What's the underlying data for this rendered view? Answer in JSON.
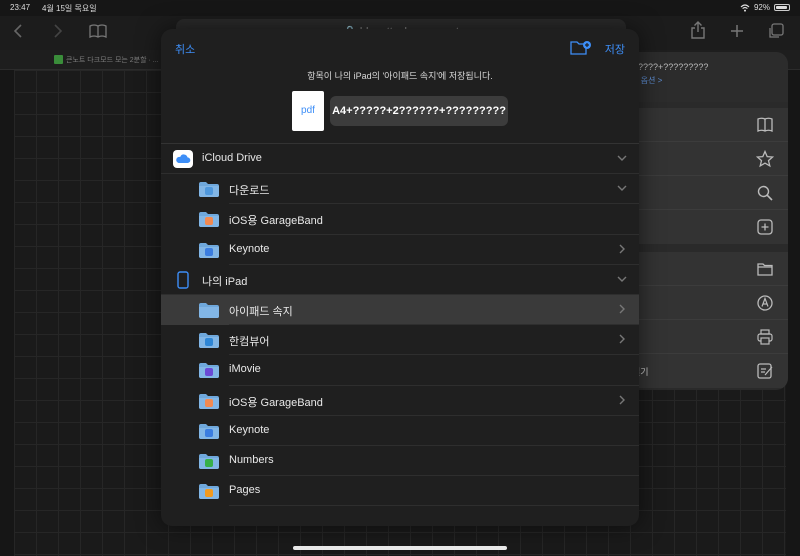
{
  "status_bar": {
    "time": "23:47",
    "date": "4월 15일 목요일",
    "battery": "92%"
  },
  "browser": {
    "url": "🔒 blogattach.naver.net",
    "tab_title": "큰노트 다크모드 모는 2분할 · ..."
  },
  "share_sheet": {
    "title": "????+?????????",
    "options_label": "3 옵션 >",
    "last_label": "결기"
  },
  "dialog": {
    "cancel_label": "취소",
    "save_label": "저장",
    "message": "항목이 나의 iPad의 '아이패드 속지'에 저장됩니다.",
    "file_type_label": "pdf",
    "file_name": "A4+?????+2??????+?????????"
  },
  "locations": [
    {
      "label": "iCloud Drive",
      "level": "root",
      "icon": "icloud-icon",
      "chevron": "down",
      "selected": false
    },
    {
      "label": "다운로드",
      "level": "child",
      "icon": "downloads-folder-icon",
      "chevron": "down",
      "selected": false
    },
    {
      "label": "iOS용 GarageBand",
      "level": "child",
      "icon": "garageband-folder-icon",
      "chevron": "none",
      "selected": false
    },
    {
      "label": "Keynote",
      "level": "child",
      "icon": "keynote-folder-icon",
      "chevron": "right",
      "selected": false
    },
    {
      "label": "나의 iPad",
      "level": "root",
      "icon": "ipad-icon",
      "chevron": "down",
      "selected": false
    },
    {
      "label": "아이패드 속지",
      "level": "child",
      "icon": "folder-icon",
      "chevron": "right",
      "selected": true
    },
    {
      "label": "한컴뷰어",
      "level": "child",
      "icon": "hancom-folder-icon",
      "chevron": "right",
      "selected": false
    },
    {
      "label": "iMovie",
      "level": "child",
      "icon": "imovie-folder-icon",
      "chevron": "none",
      "selected": false
    },
    {
      "label": "iOS용 GarageBand",
      "level": "child",
      "icon": "garageband-folder-icon",
      "chevron": "right",
      "selected": false
    },
    {
      "label": "Keynote",
      "level": "child",
      "icon": "keynote-folder-icon",
      "chevron": "none",
      "selected": false
    },
    {
      "label": "Numbers",
      "level": "child",
      "icon": "numbers-folder-icon",
      "chevron": "none",
      "selected": false
    },
    {
      "label": "Pages",
      "level": "child",
      "icon": "pages-folder-icon",
      "chevron": "none",
      "selected": false
    }
  ],
  "colors": {
    "accent": "#3d8ef7",
    "folder": "#6fa8dc",
    "garageband_badge": "#f28a52",
    "keynote_badge": "#3b7de0",
    "numbers_badge": "#37b04a",
    "pages_badge": "#f29a1f",
    "imovie_badge": "#6a4ad6",
    "hancom_badge": "#2e86d6",
    "downloads_badge": "#4f98dd"
  }
}
